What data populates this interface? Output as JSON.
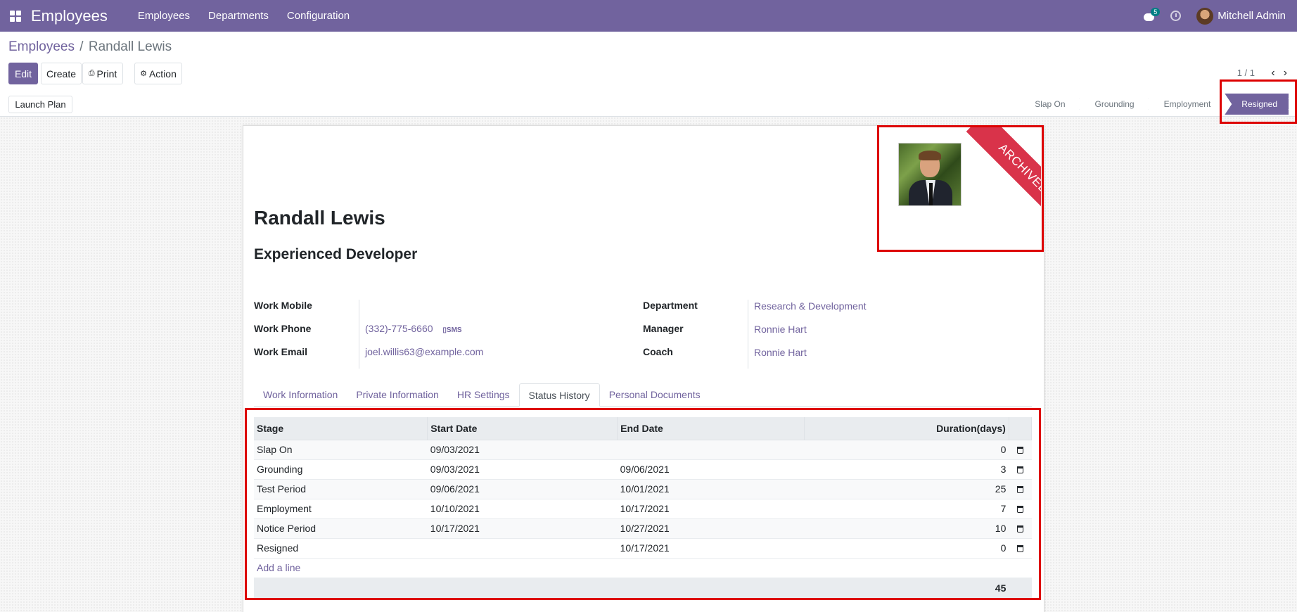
{
  "nav": {
    "app_title": "Employees",
    "menu": [
      "Employees",
      "Departments",
      "Configuration"
    ],
    "chat_badge": "5",
    "user_name": "Mitchell Admin"
  },
  "breadcrumb": {
    "parent": "Employees",
    "separator": "/",
    "current": "Randall Lewis"
  },
  "buttons": {
    "edit": "Edit",
    "create": "Create",
    "print": "Print",
    "action": "Action",
    "launch_plan": "Launch Plan"
  },
  "pager": {
    "text": "1 / 1"
  },
  "stages": [
    {
      "label": "Slap On",
      "active": false
    },
    {
      "label": "Grounding",
      "active": false
    },
    {
      "label": "Employment",
      "active": false
    },
    {
      "label": "Resigned",
      "active": true
    }
  ],
  "ribbon": "ARCHIVED",
  "employee": {
    "name": "Randall Lewis",
    "job_title": "Experienced Developer"
  },
  "fields_left": [
    {
      "label": "Work Mobile",
      "value": ""
    },
    {
      "label": "Work Phone",
      "value": "(332)-775-6660",
      "extra": "SMS"
    },
    {
      "label": "Work Email",
      "value": "joel.willis63@example.com"
    }
  ],
  "fields_right": [
    {
      "label": "Department",
      "value": "Research & Development"
    },
    {
      "label": "Manager",
      "value": "Ronnie Hart"
    },
    {
      "label": "Coach",
      "value": "Ronnie Hart"
    }
  ],
  "tabs": [
    "Work Information",
    "Private Information",
    "HR Settings",
    "Status History",
    "Personal Documents"
  ],
  "active_tab": "Status History",
  "table": {
    "headers": [
      "Stage",
      "Start Date",
      "End Date",
      "Duration(days)"
    ],
    "rows": [
      {
        "stage": "Slap On",
        "start": "09/03/2021",
        "end": "",
        "duration": "0"
      },
      {
        "stage": "Grounding",
        "start": "09/03/2021",
        "end": "09/06/2021",
        "duration": "3"
      },
      {
        "stage": "Test Period",
        "start": "09/06/2021",
        "end": "10/01/2021",
        "duration": "25"
      },
      {
        "stage": "Employment",
        "start": "10/10/2021",
        "end": "10/17/2021",
        "duration": "7"
      },
      {
        "stage": "Notice Period",
        "start": "10/17/2021",
        "end": "10/27/2021",
        "duration": "10"
      },
      {
        "stage": "Resigned",
        "start": "",
        "end": "10/17/2021",
        "duration": "0"
      }
    ],
    "add_line": "Add a line",
    "total": "45"
  },
  "colors": {
    "brand": "#71639e",
    "ribbon": "#d9334a",
    "highlight": "#dd0000"
  }
}
